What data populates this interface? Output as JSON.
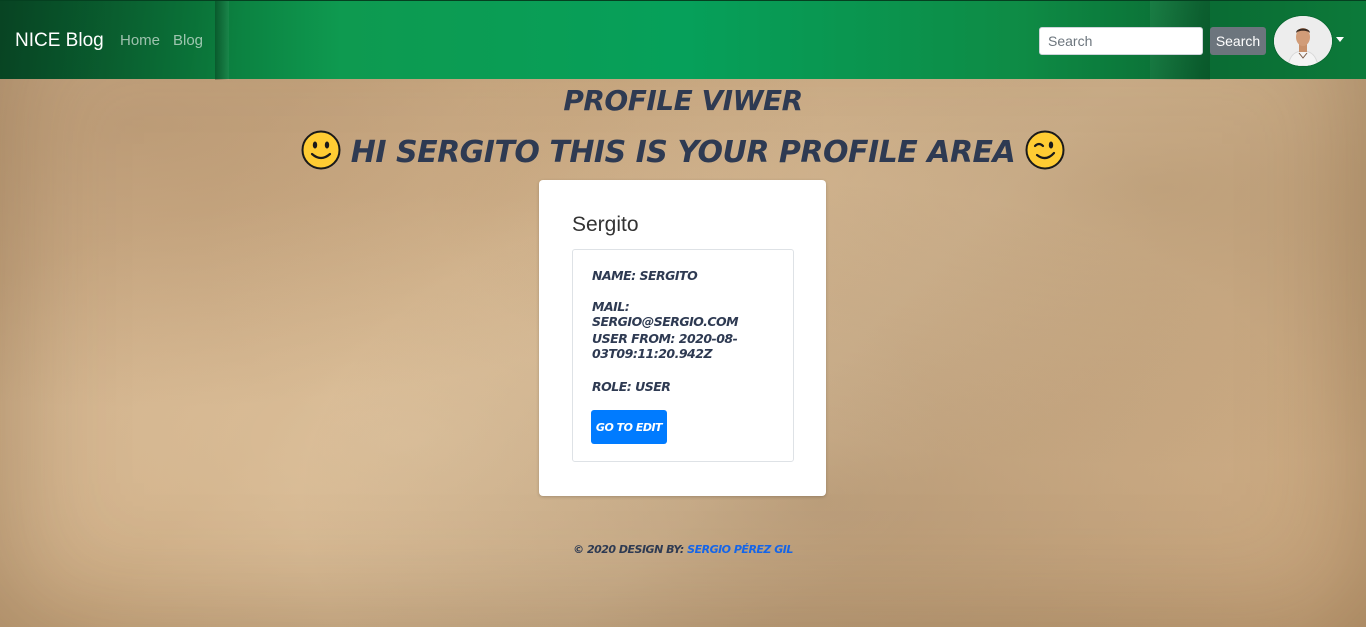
{
  "navbar": {
    "brand": "NICE Blog",
    "links": [
      {
        "label": "Home"
      },
      {
        "label": "Blog"
      }
    ],
    "search": {
      "placeholder": "Search",
      "value": "",
      "button_label": "Search"
    },
    "avatar_icon": "user-avatar"
  },
  "header": {
    "title": "Profile viwer",
    "greeting": "HI SERGITO THIS IS YOUR PROFILE AREA",
    "left_emoji": "smiling-face",
    "right_emoji": "winking-face"
  },
  "profile": {
    "card_title": "Sergito",
    "name": "NAME: SERGITO",
    "mail": "MAIL: SERGIO@SERGIO.COM",
    "user_from": "USER FROM: 2020-08-03T09:11:20.942Z",
    "role": "ROLE: USER",
    "edit_button": "GO TO EDIT"
  },
  "footer": {
    "text": "© 2020 DESIGN BY:",
    "author": "SERGIO PÉREZ GIL"
  },
  "colors": {
    "navbar": "#06a05a",
    "heading": "#2e3a52",
    "primary": "#007bff",
    "secondary": "#6c757d"
  }
}
